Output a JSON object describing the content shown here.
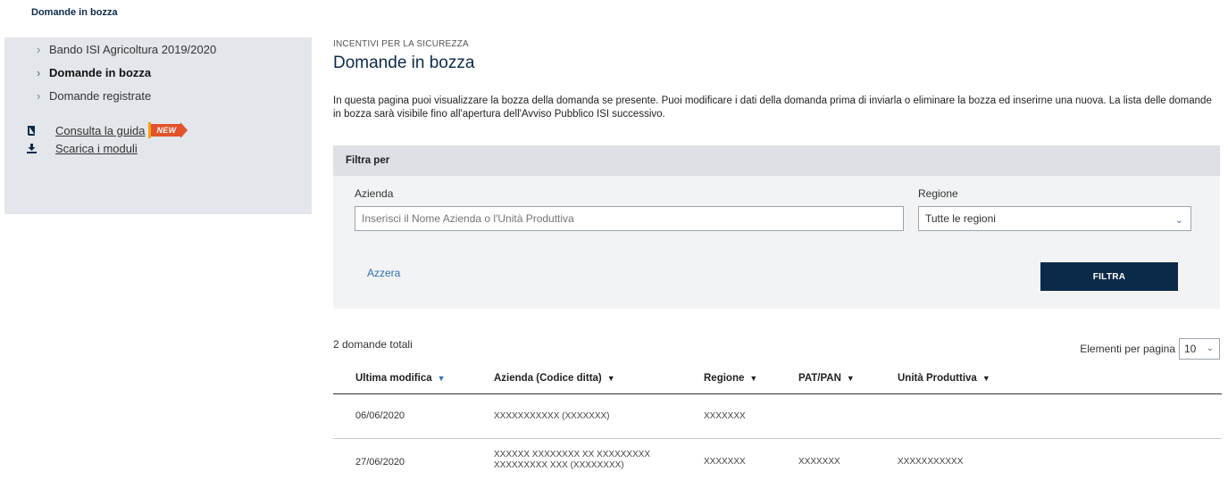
{
  "breadcrumb": "Domande in bozza",
  "sidebar": {
    "nav": [
      {
        "label": "Bando ISI Agricoltura 2019/2020",
        "active": false
      },
      {
        "label": "Domande in bozza",
        "active": true
      },
      {
        "label": "Domande registrate",
        "active": false
      }
    ],
    "links": {
      "guide": "Consulta la guida",
      "guide_badge": "NEW",
      "downloads": "Scarica i moduli"
    }
  },
  "main": {
    "section_label": "INCENTIVI PER LA SICUREZZA",
    "title": "Domande in bozza",
    "intro": "In questa pagina puoi visualizzare la bozza della domanda se presente. Puoi modificare i dati della domanda prima di inviarla o eliminare la bozza ed inserirne una nuova. La lista delle domande in bozza sarà visibile fino all'apertura dell'Avviso Pubblico ISI successivo."
  },
  "filter": {
    "heading": "Filtra per",
    "company_label": "Azienda",
    "company_placeholder": "Inserisci il Nome Azienda o l'Unità Produttiva",
    "region_label": "Regione",
    "region_value": "Tutte le regioni",
    "reset_label": "Azzera",
    "submit_label": "FILTRA"
  },
  "results": {
    "total_text": "2 domande totali",
    "per_page_label": "Elementi per pagina",
    "per_page_value": "10"
  },
  "table": {
    "headers": [
      "Ultima modifica",
      "Azienda (Codice ditta)",
      "Regione",
      "PAT/PAN",
      "Unità Produttiva"
    ],
    "rows": [
      {
        "date": "06/06/2020",
        "company_line1": "XXXXXXXXXXX (XXXXXXX)",
        "company_line2": "",
        "region": "XXXXXXX",
        "pat": "",
        "unit": ""
      },
      {
        "date": "27/06/2020",
        "company_line1": "XXXXXX XXXXXXXX XX XXXXXXXXX",
        "company_line2": "XXXXXXXXX XXX (XXXXXXXX)",
        "region": "XXXXXXX",
        "pat": "XXXXXXX",
        "unit": "XXXXXXXXXXX"
      }
    ]
  },
  "colors": {
    "primary": "#0b2a4a",
    "link": "#2f6fb3",
    "badge": "#e2522b",
    "sidebar_bg": "#e3e6ea",
    "filter_bg": "#f2f3f4"
  },
  "icons": {
    "guide": "book-icon",
    "downloads": "download-icon",
    "sort": "caret-down-icon"
  }
}
